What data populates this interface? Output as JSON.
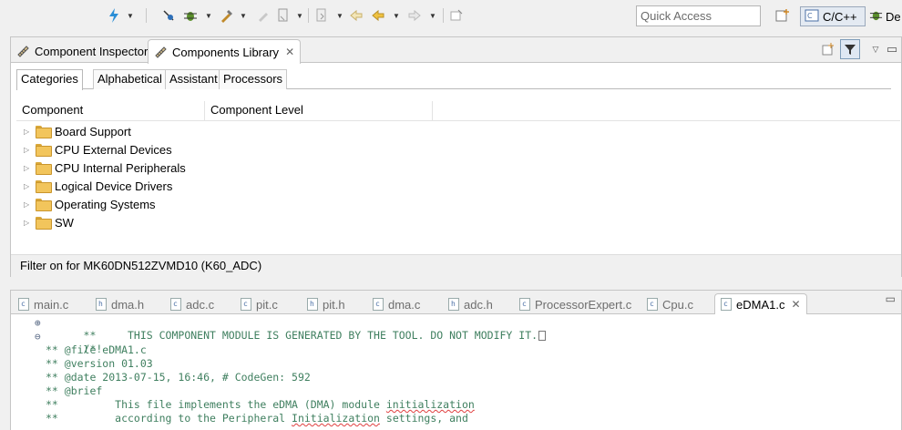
{
  "toolbar": {
    "quick_access_placeholder": "Quick Access",
    "perspective_cc": "C/C++",
    "perspective_debug": "De"
  },
  "top_panel": {
    "tabs": [
      {
        "label": "Component Inspector"
      },
      {
        "label": "Components Library"
      }
    ],
    "subtabs": [
      "Categories",
      "Alphabetical",
      "Assistant",
      "Processors"
    ],
    "columns": [
      "Component",
      "Component Level"
    ],
    "tree": [
      {
        "label": "Board Support"
      },
      {
        "label": "CPU External Devices"
      },
      {
        "label": "CPU Internal Peripherals"
      },
      {
        "label": "Logical Device Drivers"
      },
      {
        "label": "Operating Systems"
      },
      {
        "label": "SW"
      }
    ],
    "filter_text": "Filter on for MK60DN512ZVMD10 (K60_ADC)"
  },
  "editor": {
    "tabs": [
      {
        "label": "main.c",
        "ext": "c"
      },
      {
        "label": "dma.h",
        "ext": "h"
      },
      {
        "label": "adc.c",
        "ext": "c"
      },
      {
        "label": "pit.c",
        "ext": "c"
      },
      {
        "label": "pit.h",
        "ext": "h"
      },
      {
        "label": "dma.c",
        "ext": "c"
      },
      {
        "label": "adc.h",
        "ext": "h"
      },
      {
        "label": "ProcessorExpert.c",
        "ext": "c"
      },
      {
        "label": "Cpu.c",
        "ext": "c"
      },
      {
        "label": "eDMA1.c",
        "ext": "c"
      }
    ],
    "code": {
      "l1": "**     THIS COMPONENT MODULE IS GENERATED BY THE TOOL. DO NOT MODIFY IT.",
      "l2": "/*!",
      "l3": "** @file eDMA1.c",
      "l4": "** @version 01.03",
      "l5": "** @date 2013-07-15, 16:46, # CodeGen: 592",
      "l6": "** @brief",
      "l7a": "**         This file implements the eDMA (DMA) module ",
      "l7b": "initialization",
      "l8a": "**         according to the Peripheral ",
      "l8b": "Initialization",
      "l8c": " settings, and"
    }
  },
  "colors": {
    "comment_green": "#3f7f5f",
    "folder_yellow": "#f2c55c"
  }
}
